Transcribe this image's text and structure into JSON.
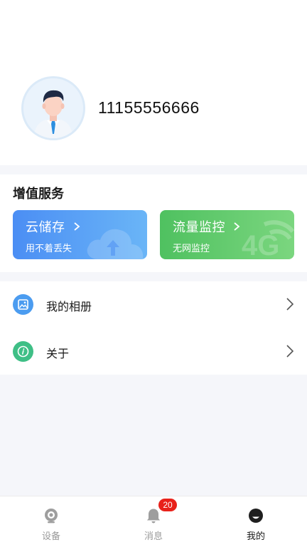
{
  "profile": {
    "phone": "11155556666"
  },
  "vas": {
    "title": "增值服务",
    "cards": [
      {
        "title": "云储存",
        "subtitle": "用不着丢失",
        "color": "#4b8ef4"
      },
      {
        "title": "流量监控",
        "subtitle": "无网监控",
        "color": "#4fc160"
      }
    ]
  },
  "menu": {
    "items": [
      {
        "label": "我的相册",
        "icon": "photo-album-icon",
        "color": "#4b9cf0"
      },
      {
        "label": "关于",
        "icon": "info-icon",
        "color": "#3fbf86"
      }
    ]
  },
  "tabbar": {
    "tabs": [
      {
        "label": "设备",
        "icon": "camera-icon",
        "active": false
      },
      {
        "label": "消息",
        "icon": "bell-icon",
        "active": false,
        "badge": "20"
      },
      {
        "label": "我的",
        "icon": "smiley-icon",
        "active": true
      }
    ]
  }
}
